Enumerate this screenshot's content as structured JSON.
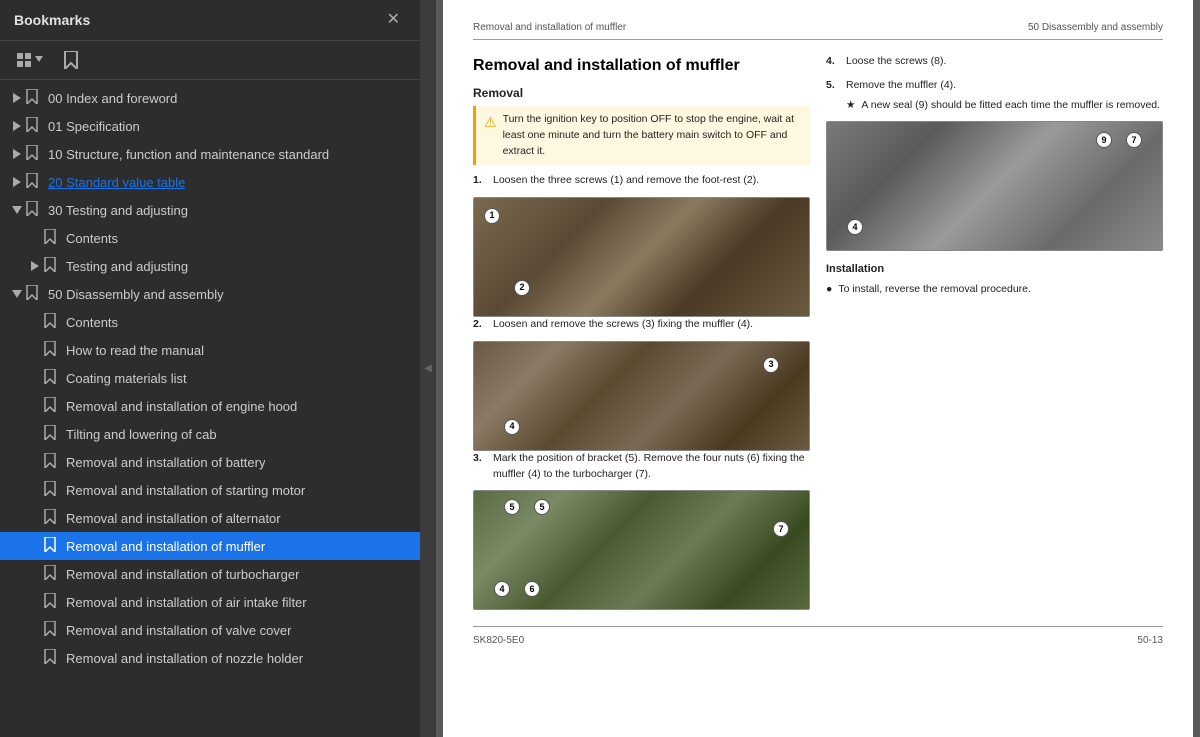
{
  "bookmarks": {
    "title": "Bookmarks",
    "close_label": "✕",
    "toolbar": {
      "btn1_label": "⊞▾",
      "btn2_label": "🔖"
    },
    "items": [
      {
        "id": "item-00",
        "indent": 0,
        "toggle": "right",
        "icon": "bookmark",
        "label": "00 Index and foreword",
        "active": false
      },
      {
        "id": "item-01",
        "indent": 0,
        "toggle": "right",
        "icon": "bookmark",
        "label": "01 Specification",
        "active": false
      },
      {
        "id": "item-10",
        "indent": 0,
        "toggle": "right",
        "icon": "bookmark",
        "label": "10 Structure, function and maintenance standard",
        "active": false
      },
      {
        "id": "item-20",
        "indent": 0,
        "toggle": "right",
        "icon": "bookmark",
        "label": "20 Standard value table",
        "active": false,
        "link": true
      },
      {
        "id": "item-30",
        "indent": 0,
        "toggle": "down",
        "icon": "bookmark",
        "label": "30 Testing and adjusting",
        "active": false
      },
      {
        "id": "item-30-contents",
        "indent": 1,
        "toggle": "",
        "icon": "bookmark",
        "label": "Contents",
        "active": false
      },
      {
        "id": "item-30-testing",
        "indent": 1,
        "toggle": "right",
        "icon": "bookmark",
        "label": "Testing and adjusting",
        "active": false
      },
      {
        "id": "item-50",
        "indent": 0,
        "toggle": "down",
        "icon": "bookmark",
        "label": "50 Disassembly and assembly",
        "active": false
      },
      {
        "id": "item-50-contents",
        "indent": 1,
        "toggle": "",
        "icon": "bookmark",
        "label": "Contents",
        "active": false
      },
      {
        "id": "item-50-howto",
        "indent": 1,
        "toggle": "",
        "icon": "bookmark",
        "label": "How to read the manual",
        "active": false
      },
      {
        "id": "item-50-coating",
        "indent": 1,
        "toggle": "",
        "icon": "bookmark",
        "label": "Coating materials list",
        "active": false
      },
      {
        "id": "item-50-enginehood",
        "indent": 1,
        "toggle": "",
        "icon": "bookmark",
        "label": "Removal and installation of engine hood",
        "active": false
      },
      {
        "id": "item-50-cab",
        "indent": 1,
        "toggle": "",
        "icon": "bookmark",
        "label": "Tilting and lowering of cab",
        "active": false
      },
      {
        "id": "item-50-battery",
        "indent": 1,
        "toggle": "",
        "icon": "bookmark",
        "label": "Removal and installation of battery",
        "active": false
      },
      {
        "id": "item-50-starting",
        "indent": 1,
        "toggle": "",
        "icon": "bookmark",
        "label": "Removal and installation of starting motor",
        "active": false
      },
      {
        "id": "item-50-alternator",
        "indent": 1,
        "toggle": "",
        "icon": "bookmark",
        "label": "Removal and installation of alternator",
        "active": false
      },
      {
        "id": "item-50-muffler",
        "indent": 1,
        "toggle": "",
        "icon": "bookmark",
        "label": "Removal and installation of muffler",
        "active": true
      },
      {
        "id": "item-50-turbo",
        "indent": 1,
        "toggle": "",
        "icon": "bookmark",
        "label": "Removal and installation of turbocharger",
        "active": false
      },
      {
        "id": "item-50-airfilter",
        "indent": 1,
        "toggle": "",
        "icon": "bookmark",
        "label": "Removal and installation of air intake filter",
        "active": false
      },
      {
        "id": "item-50-valvecover",
        "indent": 1,
        "toggle": "",
        "icon": "bookmark",
        "label": "Removal and installation of valve cover",
        "active": false
      },
      {
        "id": "item-50-nozzle",
        "indent": 1,
        "toggle": "",
        "icon": "bookmark",
        "label": "Removal and installation of nozzle holder",
        "active": false
      }
    ]
  },
  "page": {
    "header_left": "Removal and installation of muffler",
    "header_right": "50 Disassembly and assembly",
    "main_title": "Removal and installation of muffler",
    "removal_title": "Removal",
    "warning_text": "Turn the ignition key to position OFF to stop the engine, wait at least one minute and turn the battery main switch to OFF and extract it.",
    "steps": [
      {
        "num": "1.",
        "text": "Loosen the three screws (1) and remove the foot-rest (2)."
      },
      {
        "num": "2.",
        "text": "Loosen and remove the screws (3) fixing the muffler (4)."
      },
      {
        "num": "3.",
        "text": "Mark the position of bracket (5). Remove the four nuts (6) fixing the muffler (4) to the turbocharger (7)."
      }
    ],
    "right_steps": [
      {
        "num": "4.",
        "text": "Loose the screws (8)."
      },
      {
        "num": "5.",
        "text": "Remove the muffler (4).",
        "sub_bullet": "A new seal (9) should be fitted each time the muffler is removed."
      }
    ],
    "installation_title": "Installation",
    "installation_text": "To install, reverse the removal procedure.",
    "footer_left": "SK820-5E0",
    "footer_right": "50-13"
  }
}
